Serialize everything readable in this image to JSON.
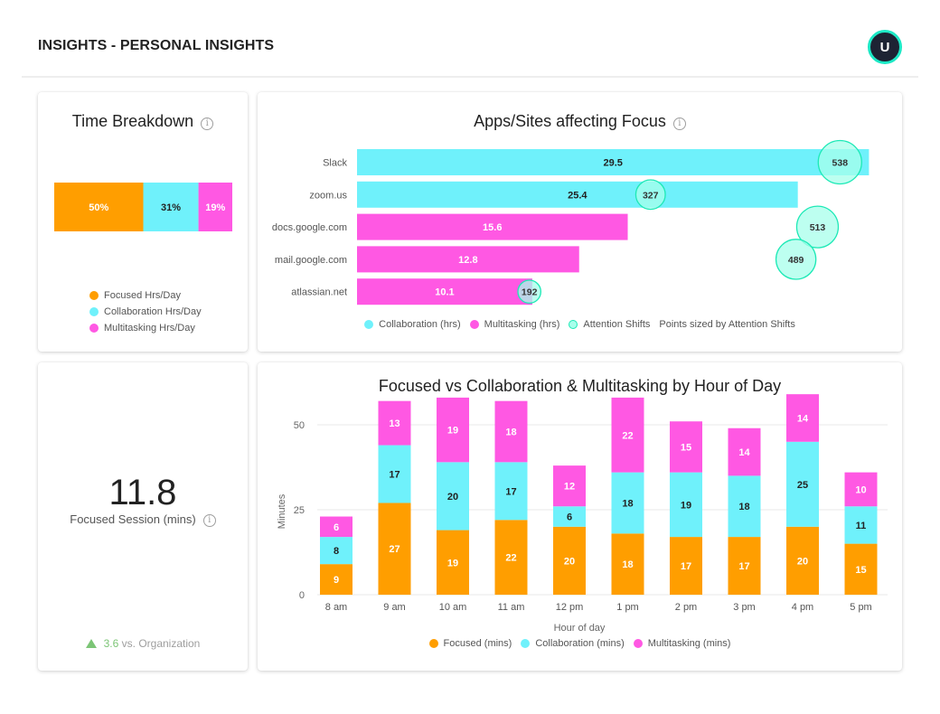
{
  "header": {
    "title": "INSIGHTS - PERSONAL INSIGHTS",
    "avatar_initial": "U"
  },
  "colors": {
    "focused": "#ff9e00",
    "collaboration": "#6ff1fb",
    "multitasking": "#ff58e3",
    "attention_fill": "#a7ffeb",
    "attention_stroke": "#1de9b6",
    "positive": "#7cc576"
  },
  "info_icon_glyph": "i",
  "time_breakdown": {
    "title": "Time Breakdown",
    "legend": [
      "Focused Hrs/Day",
      "Collaboration Hrs/Day",
      "Multitasking Hrs/Day"
    ]
  },
  "apps": {
    "title": "Apps/Sites affecting Focus",
    "legend": [
      "Collaboration (hrs)",
      "Multitasking (hrs)",
      "Attention Shifts",
      "Points sized by Attention Shifts"
    ]
  },
  "session": {
    "value": "11.8",
    "label": "Focused Session (mins)",
    "compare_value": "3.6",
    "compare_text": " vs. Organization"
  },
  "hours": {
    "title": "Focused vs Collaboration & Multitasking by Hour of Day",
    "legend": [
      "Focused (mins)",
      "Collaboration (mins)",
      "Multitasking (mins)"
    ]
  },
  "chart_data": [
    {
      "type": "bar",
      "orientation": "horizontal-stacked-100",
      "title": "Time Breakdown",
      "categories": [
        "Focused Hrs/Day",
        "Collaboration Hrs/Day",
        "Multitasking Hrs/Day"
      ],
      "values": [
        50,
        31,
        19
      ],
      "labels": [
        "50%",
        "31%",
        "19%"
      ],
      "legend_position": "bottom"
    },
    {
      "type": "bar",
      "orientation": "horizontal",
      "title": "Apps/Sites affecting Focus",
      "categories": [
        "Slack",
        "zoom.us",
        "docs.google.com",
        "mail.google.com",
        "atlassian.net"
      ],
      "series": [
        {
          "name": "Hours",
          "values": [
            29.5,
            25.4,
            15.6,
            12.8,
            10.1
          ],
          "kind": [
            "Collaboration (hrs)",
            "Collaboration (hrs)",
            "Multitasking (hrs)",
            "Multitasking (hrs)",
            "Multitasking (hrs)"
          ]
        },
        {
          "name": "Attention Shifts",
          "values": [
            538,
            327,
            513,
            489,
            192
          ],
          "marker": "bubble"
        }
      ],
      "xlim": [
        0,
        30
      ],
      "attention_xlim": [
        0,
        580
      ],
      "legend_position": "bottom",
      "note": "Points sized by Attention Shifts"
    },
    {
      "type": "bar",
      "orientation": "vertical-stacked",
      "title": "Focused vs Collaboration & Multitasking by Hour of Day",
      "categories": [
        "8 am",
        "9 am",
        "10 am",
        "11 am",
        "12 pm",
        "1 pm",
        "2 pm",
        "3 pm",
        "4 pm",
        "5 pm"
      ],
      "series": [
        {
          "name": "Focused (mins)",
          "values": [
            9,
            27,
            19,
            22,
            20,
            18,
            17,
            17,
            20,
            15
          ]
        },
        {
          "name": "Collaboration (mins)",
          "values": [
            8,
            17,
            20,
            17,
            6,
            18,
            19,
            18,
            25,
            11
          ]
        },
        {
          "name": "Multitasking (mins)",
          "values": [
            6,
            13,
            19,
            18,
            12,
            22,
            15,
            14,
            14,
            10
          ]
        }
      ],
      "xlabel": "Hour of day",
      "ylabel": "Minutes",
      "yticks": [
        0,
        25,
        50
      ],
      "ylim": [
        0,
        55
      ],
      "grid": true,
      "legend_position": "bottom"
    }
  ]
}
